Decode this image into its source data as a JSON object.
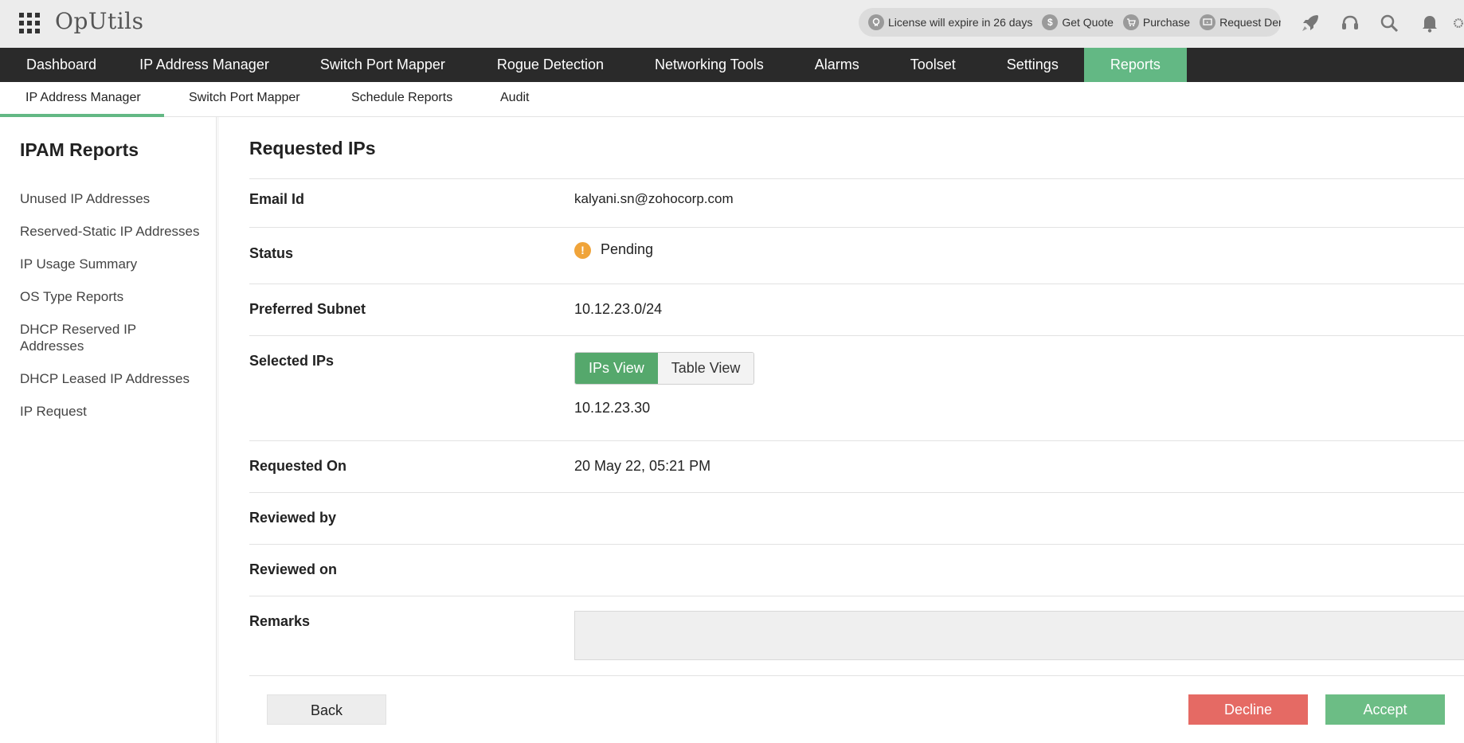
{
  "app": {
    "title": "OpUtils"
  },
  "header": {
    "license_text": "License will expire in 26 days",
    "get_quote": "Get Quote",
    "purchase": "Purchase",
    "request_demo": "Request Demo",
    "icons": [
      "rocket-icon",
      "headset-icon",
      "search-icon",
      "bell-icon",
      "gear-icon"
    ]
  },
  "nav": {
    "items": [
      {
        "label": "Dashboard"
      },
      {
        "label": "IP Address Manager"
      },
      {
        "label": "Switch Port Mapper"
      },
      {
        "label": "Rogue Detection"
      },
      {
        "label": "Networking Tools"
      },
      {
        "label": "Alarms"
      },
      {
        "label": "Toolset"
      },
      {
        "label": "Settings"
      },
      {
        "label": "Reports",
        "active": true
      }
    ],
    "active_color": "#63b884"
  },
  "subnav": {
    "items": [
      {
        "label": "IP Address Manager",
        "active": true
      },
      {
        "label": "Switch Port Mapper"
      },
      {
        "label": "Schedule Reports"
      },
      {
        "label": "Audit"
      }
    ]
  },
  "sidebar": {
    "title": "IPAM Reports",
    "items": [
      {
        "label": "Unused IP Addresses"
      },
      {
        "label": "Reserved-Static IP Addresses"
      },
      {
        "label": "IP Usage Summary"
      },
      {
        "label": "OS Type Reports"
      },
      {
        "label": "DHCP Reserved IP Addresses"
      },
      {
        "label": "DHCP Leased IP Addresses"
      },
      {
        "label": "IP Request"
      }
    ]
  },
  "detail": {
    "title": "Requested IPs",
    "email_label": "Email Id",
    "email_value": "kalyani.sn@zohocorp.com",
    "status_label": "Status",
    "status_value": "Pending",
    "status_color": "#f0a43a",
    "subnet_label": "Preferred Subnet",
    "subnet_value": "10.12.23.0/24",
    "selected_label": "Selected IPs",
    "view_ips": "IPs View",
    "view_table": "Table View",
    "selected_value": "10.12.23.30",
    "requested_on_label": "Requested On",
    "requested_on_value": "20 May 22, 05:21 PM",
    "reviewed_by_label": "Reviewed by",
    "reviewed_on_label": "Reviewed on",
    "remarks_label": "Remarks",
    "remarks_value": ""
  },
  "actions": {
    "back": "Back",
    "decline": "Decline",
    "accept": "Accept"
  }
}
